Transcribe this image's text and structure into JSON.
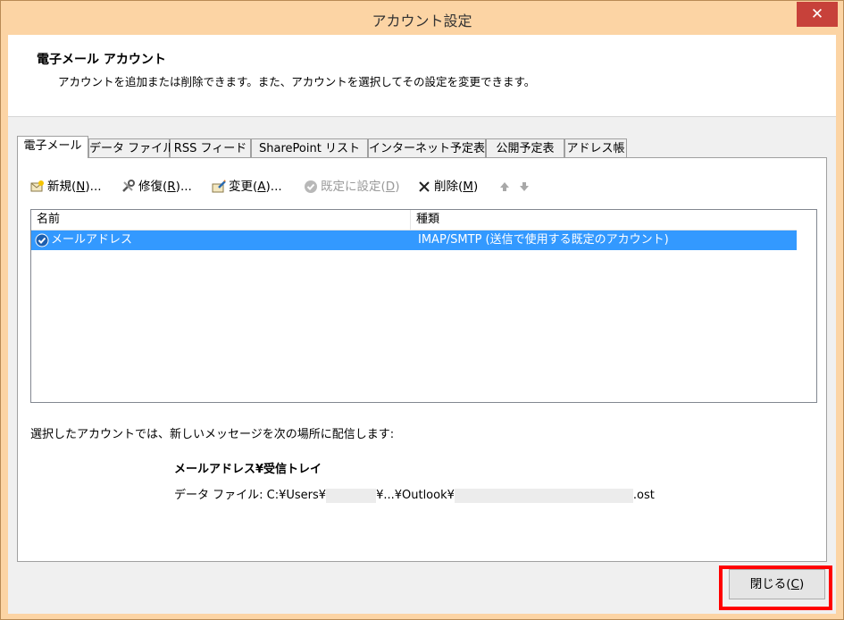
{
  "window": {
    "title": "アカウント設定",
    "close_glyph": "✕",
    "titlebar_color": "#fcd4a4",
    "close_color": "#c7413a"
  },
  "header": {
    "title": "電子メール アカウント",
    "description": "アカウントを追加または削除できます。また、アカウントを選択してその設定を変更できます。"
  },
  "tabs": [
    {
      "label": "電子メール",
      "active": true
    },
    {
      "label": "データ ファイル"
    },
    {
      "label": "RSS フィード"
    },
    {
      "label": "SharePoint リスト"
    },
    {
      "label": "インターネット予定表"
    },
    {
      "label": "公開予定表"
    },
    {
      "label": "アドレス帳"
    }
  ],
  "toolbar": {
    "new_label": "新規(",
    "new_key": "N",
    "new_suffix": ")...",
    "repair_label": "修復(",
    "repair_key": "R",
    "repair_suffix": ")...",
    "change_label": "変更(",
    "change_key": "A",
    "change_suffix": ")...",
    "default_label": "既定に設定(",
    "default_key": "D",
    "default_suffix": ")",
    "delete_label": "削除(",
    "delete_key": "M",
    "delete_suffix": ")",
    "icons": [
      "new-account-icon",
      "repair-icon",
      "change-icon",
      "check-default-icon",
      "delete-x-icon",
      "arrow-up-icon",
      "arrow-down-icon"
    ]
  },
  "accounts_table": {
    "columns": [
      "名前",
      "種類"
    ],
    "rows": [
      {
        "name": "メールアドレス",
        "type": "IMAP/SMTP (送信で使用する既定のアカウント)",
        "selected": true
      }
    ],
    "selection_color": "#3399ff"
  },
  "delivery": {
    "label": "選択したアカウントでは、新しいメッセージを次の場所に配信します:",
    "folder": "メールアドレス¥受信トレイ",
    "datafile_prefix": "データ ファイル: C:¥Users¥",
    "datafile_mid": "¥...¥Outlook¥",
    "datafile_suffix": ".ost"
  },
  "footer": {
    "close_label": "閉じる(",
    "close_key": "C",
    "close_suffix": ")",
    "highlight_color": "#ff0000"
  }
}
